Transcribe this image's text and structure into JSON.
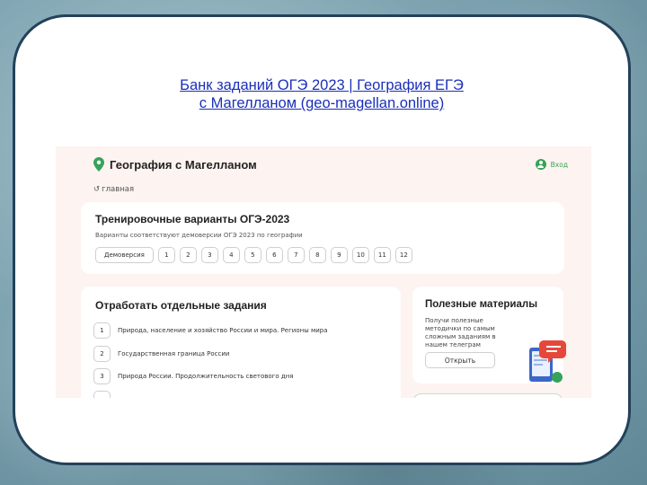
{
  "slide": {
    "title_line1": "Банк заданий ОГЭ 2023 | География ЕГЭ",
    "title_line2": "с Магелланом (geo-magellan.online)"
  },
  "site": {
    "logo_text": "География с Магелланом",
    "login_label": "Вход",
    "back_label": "главная",
    "brand_color": "#35a35a"
  },
  "training": {
    "title": "Тренировочные варианты ОГЭ-2023",
    "subtitle": "Варианты соответствуют демоверсии ОГЭ 2023 по географии",
    "demo_label": "Демоверсия",
    "variants": [
      "1",
      "2",
      "3",
      "4",
      "5",
      "6",
      "7",
      "8",
      "9",
      "10",
      "11",
      "12"
    ]
  },
  "tasks": {
    "title": "Отработать отдельные задания",
    "items": [
      {
        "num": "1",
        "label": "Природа, население и хозяйство России и мира. Регионы мира"
      },
      {
        "num": "2",
        "label": "Государственная граница России"
      },
      {
        "num": "3",
        "label": "Природа России. Продолжительность светового дня"
      }
    ]
  },
  "materials": {
    "title": "Полезные материалы",
    "description": "Получи полезные методички по самым сложным заданиям в нашем телеграм",
    "open_label": "Открыть"
  }
}
